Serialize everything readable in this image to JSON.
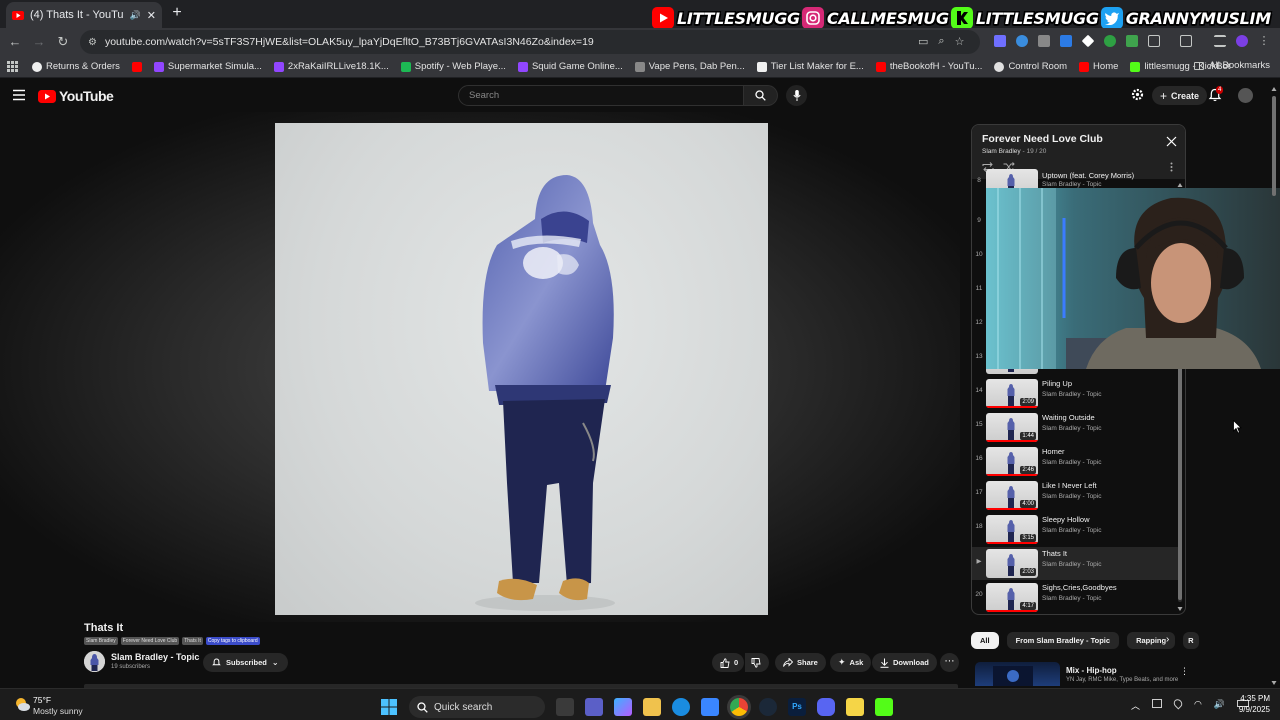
{
  "browser": {
    "tab_title": "(4) Thats It - YouTube",
    "url": "youtube.com/watch?v=5sTF3S7HjWE&list=OLAK5uy_lpaYjDqEfltO_B73BTj6GVATAsI3N46Zo&index=19",
    "bookmarks": [
      {
        "label": "Returns & Orders",
        "color": "#f0f0f0"
      },
      {
        "label": "",
        "color": "#ff0000"
      },
      {
        "label": "Supermarket Simula...",
        "color": "#9146ff"
      },
      {
        "label": "2xRaKaiIRLLive18.1K...",
        "color": "#9146ff"
      },
      {
        "label": "Spotify - Web Playe...",
        "color": "#1db954"
      },
      {
        "label": "Squid Game Online...",
        "color": "#9146ff"
      },
      {
        "label": "Vape Pens, Dab Pen...",
        "color": "#888888"
      },
      {
        "label": "Tier List Maker for E...",
        "color": "#f0f0f0"
      },
      {
        "label": "theBookofH - YouTu...",
        "color": "#ff0000"
      },
      {
        "label": "Control Room",
        "color": "#e0e0e0"
      },
      {
        "label": "Home",
        "color": "#ff0000"
      },
      {
        "label": "littlesmugg - KickBot",
        "color": "#53fc18"
      }
    ],
    "all_bookmarks": "All Bookmarks"
  },
  "stream_overlay": [
    {
      "icon": "youtube-icon",
      "text": "LITTLESMUGG",
      "color": "#ff0000"
    },
    {
      "icon": "instagram-icon",
      "text": "CALLMESMUG",
      "color": "#d62976"
    },
    {
      "icon": "kick-icon",
      "text": "LITTLESMUGG",
      "color": "#53fc18"
    },
    {
      "icon": "twitter-icon",
      "text": "GRANNYMUSLIM",
      "color": "#1da1f2"
    }
  ],
  "youtube": {
    "logo": "YouTube",
    "search_placeholder": "Search",
    "create": "Create",
    "notifications": "4"
  },
  "video": {
    "title": "Thats It",
    "tags": [
      "Slam Bradley",
      "Forever Need Love Club",
      "Thats It",
      "Copy tags to clipboard"
    ],
    "channel": "Slam Bradley - Topic",
    "subscribers": "19 subscribers",
    "subscribed": "Subscribed",
    "likes": "0",
    "share": "Share",
    "ask": "Ask",
    "download": "Download"
  },
  "playlist": {
    "title": "Forever Need Love Club",
    "owner": "Slam Bradley",
    "position": "19 / 20",
    "items": [
      {
        "index": "8",
        "title": "Uptown (feat. Corey Morris)",
        "artist": "Slam Bradley - Topic",
        "duration": ""
      },
      {
        "index": "9",
        "title": "",
        "artist": "",
        "duration": ""
      },
      {
        "index": "10",
        "title": "",
        "artist": "",
        "duration": ""
      },
      {
        "index": "11",
        "title": "",
        "artist": "",
        "duration": ""
      },
      {
        "index": "12",
        "title": "",
        "artist": "",
        "duration": ""
      },
      {
        "index": "13",
        "title": "",
        "artist": "",
        "duration": ""
      },
      {
        "index": "14",
        "title": "Piling Up",
        "artist": "Slam Bradley - Topic",
        "duration": "2:09"
      },
      {
        "index": "15",
        "title": "Waiting Outside",
        "artist": "Slam Bradley - Topic",
        "duration": "1:44"
      },
      {
        "index": "16",
        "title": "Homer",
        "artist": "Slam Bradley - Topic",
        "duration": "2:46"
      },
      {
        "index": "17",
        "title": "Like I Never Left",
        "artist": "Slam Bradley - Topic",
        "duration": "4:00"
      },
      {
        "index": "18",
        "title": "Sleepy Hollow",
        "artist": "Slam Bradley - Topic",
        "duration": "3:15"
      },
      {
        "index": "▶",
        "title": "Thats It",
        "artist": "Slam Bradley - Topic",
        "duration": "2:03",
        "active": true
      },
      {
        "index": "20",
        "title": "Sighs,Cries,Goodbyes",
        "artist": "Slam Bradley - Topic",
        "duration": "4:17"
      }
    ]
  },
  "chips": [
    "All",
    "From Slam Bradley - Topic",
    "Rapping",
    "R"
  ],
  "recommendation": {
    "title": "Mix - Hip-hop",
    "subtitle": "YN Jay, RMC Mike, Type Beats, and more"
  },
  "taskbar": {
    "temperature": "75°F",
    "weather": "Mostly sunny",
    "search": "Quick search",
    "time": "4:35 PM",
    "date": "9/9/2025"
  },
  "colors": {
    "youtube_red": "#ff0000",
    "background": "#0f0f0f",
    "chip_selected": "#f1f1f1"
  }
}
